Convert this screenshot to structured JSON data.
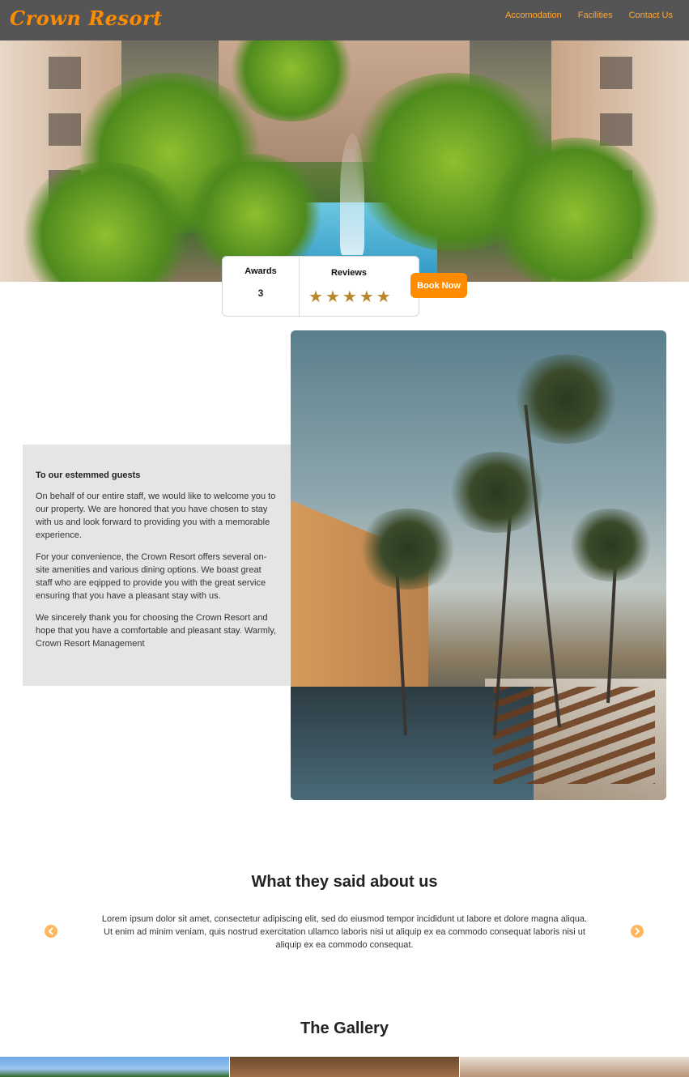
{
  "header": {
    "brand": "Crown Resort",
    "nav": [
      "Accomodation",
      "Facilities",
      "Contact Us"
    ]
  },
  "stats": {
    "awards_label": "Awards",
    "awards_value": "3",
    "reviews_label": "Reviews",
    "reviews_rating": 5,
    "reviews_max": 5
  },
  "book_button": "Book Now",
  "welcome": {
    "title": "To our estemmed guests",
    "paragraphs": [
      "On behalf of our entire staff, we would like to welcome you to our property. We are honored that you have chosen to stay with us and look forward to providing you with a memorable experience.",
      "For your convenience, the Crown Resort offers several on-site amenities and various dining options. We boast great staff who are eqipped to provide you with the great service ensuring that you have a pleasant stay with us.",
      "We sincerely thank you for choosing the Crown Resort and hope that you have a comfortable and pleasant stay. Warmly, Crown Resort Management"
    ]
  },
  "testimonials": {
    "title": "What they said about us",
    "text": "Lorem ipsum dolor sit amet, consectetur adipiscing elit, sed do eiusmod tempor incididunt ut labore et dolore magna aliqua. Ut enim ad minim veniam, quis nostrud exercitation ullamco laboris nisi ut aliquip ex ea commodo consequat laboris nisi ut aliquip ex ea commodo consequat."
  },
  "gallery": {
    "title": "The Gallery"
  },
  "colors": {
    "accent": "#ff8c00",
    "navbar": "#555555",
    "star": "#b8862b"
  }
}
